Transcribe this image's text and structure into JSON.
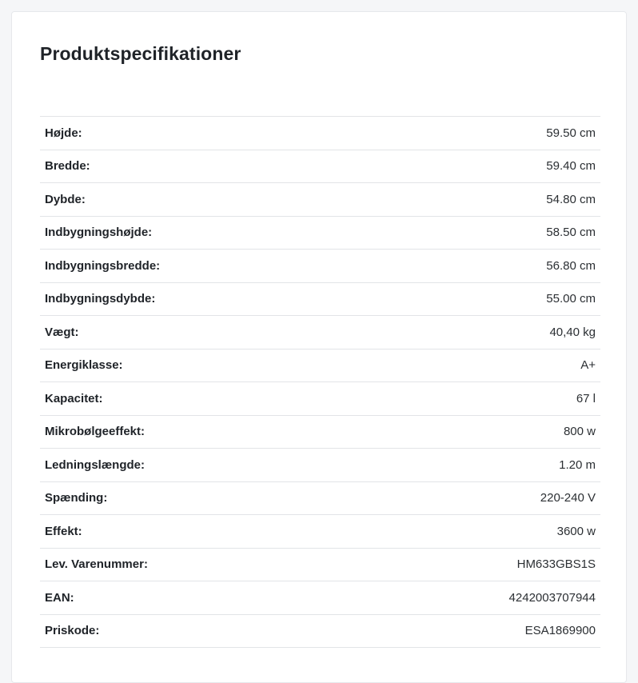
{
  "title": "Produktspecifikationer",
  "specs": [
    {
      "label": "Højde:",
      "value": "59.50 cm"
    },
    {
      "label": "Bredde:",
      "value": "59.40 cm"
    },
    {
      "label": "Dybde:",
      "value": "54.80 cm"
    },
    {
      "label": "Indbygningshøjde:",
      "value": "58.50 cm"
    },
    {
      "label": "Indbygningsbredde:",
      "value": "56.80 cm"
    },
    {
      "label": "Indbygningsdybde:",
      "value": "55.00 cm"
    },
    {
      "label": "Vægt:",
      "value": "40,40 kg"
    },
    {
      "label": "Energiklasse:",
      "value": "A+"
    },
    {
      "label": "Kapacitet:",
      "value": "67 l"
    },
    {
      "label": "Mikrobølgeeffekt:",
      "value": "800 w"
    },
    {
      "label": "Ledningslængde:",
      "value": "1.20 m"
    },
    {
      "label": "Spænding:",
      "value": "220-240 V"
    },
    {
      "label": "Effekt:",
      "value": "3600 w"
    },
    {
      "label": "Lev. Varenummer:",
      "value": "HM633GBS1S"
    },
    {
      "label": "EAN:",
      "value": "4242003707944"
    },
    {
      "label": "Priskode:",
      "value": "ESA1869900"
    }
  ]
}
